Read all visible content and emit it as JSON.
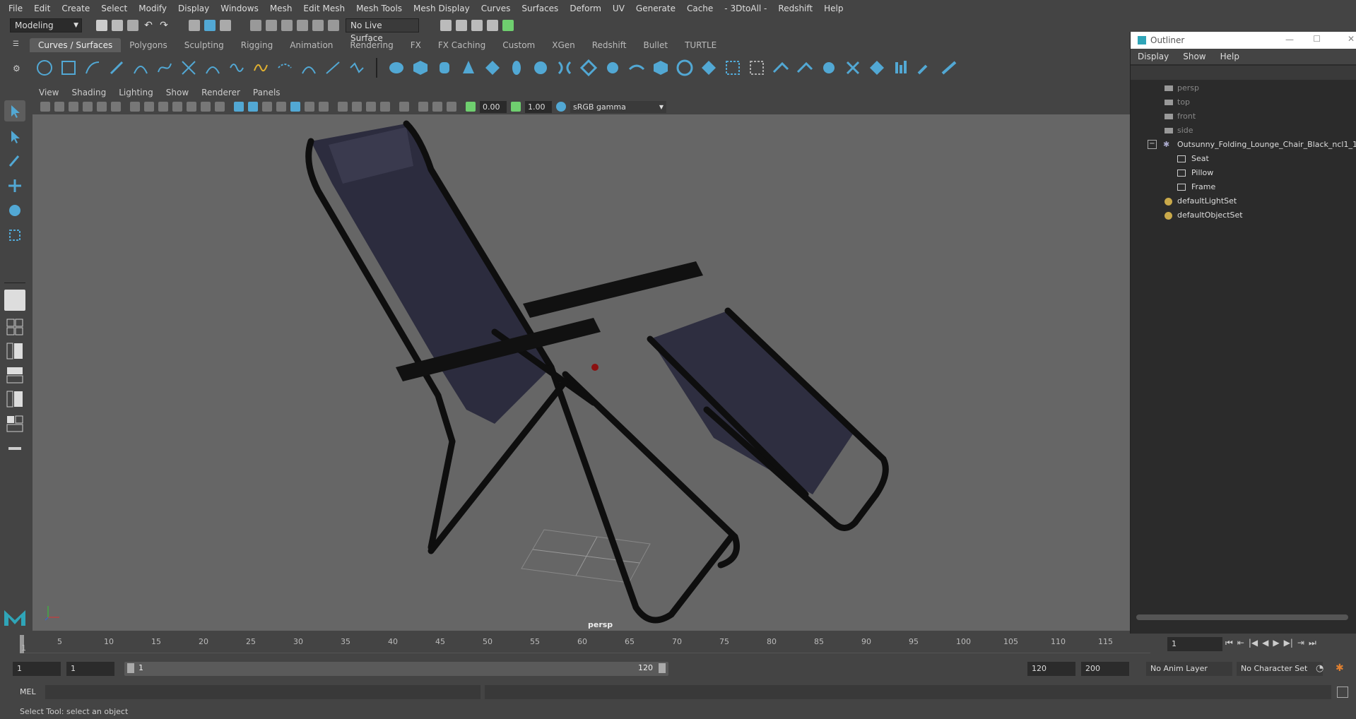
{
  "menubar": {
    "items": [
      "File",
      "Edit",
      "Create",
      "Select",
      "Modify",
      "Display",
      "Windows",
      "Mesh",
      "Edit Mesh",
      "Mesh Tools",
      "Mesh Display",
      "Curves",
      "Surfaces",
      "Deform",
      "UV",
      "Generate",
      "Cache",
      "- 3DtoAll -",
      "Redshift",
      "Help"
    ]
  },
  "statusline": {
    "mode": "Modeling",
    "live_surface": "No Live Surface"
  },
  "shelf": {
    "tabs": [
      "Curves / Surfaces",
      "Polygons",
      "Sculpting",
      "Rigging",
      "Animation",
      "Rendering",
      "FX",
      "FX Caching",
      "Custom",
      "XGen",
      "Redshift",
      "Bullet",
      "TURTLE"
    ]
  },
  "panel": {
    "menu": [
      "View",
      "Shading",
      "Lighting",
      "Show",
      "Renderer",
      "Panels"
    ],
    "exposure": "0.00",
    "gamma": "1.00",
    "color_space": "sRGB gamma",
    "camera_label": "persp"
  },
  "outliner": {
    "title": "Outliner",
    "menu": [
      "Display",
      "Show",
      "Help"
    ],
    "items": [
      {
        "label": "persp"
      },
      {
        "label": "top"
      },
      {
        "label": "front"
      },
      {
        "label": "side"
      },
      {
        "label": "Outsunny_Folding_Lounge_Chair_Black_ncl1_1"
      },
      {
        "label": "Seat"
      },
      {
        "label": "Pillow"
      },
      {
        "label": "Frame"
      },
      {
        "label": "defaultLightSet"
      },
      {
        "label": "defaultObjectSet"
      }
    ]
  },
  "timeline": {
    "ticks": [
      "1",
      "5",
      "10",
      "15",
      "20",
      "25",
      "30",
      "35",
      "40",
      "45",
      "50",
      "55",
      "60",
      "65",
      "70",
      "75",
      "80",
      "85",
      "90",
      "95",
      "100",
      "105",
      "110",
      "115"
    ],
    "current_frame": "1"
  },
  "range": {
    "start": "1",
    "anim_start": "1",
    "slider_start": "1",
    "slider_end": "120",
    "anim_end": "120",
    "end": "200",
    "anim_layer": "No Anim Layer",
    "character_set": "No Character Set"
  },
  "cmdline": {
    "label": "MEL"
  },
  "helpline": {
    "text": "Select Tool: select an object"
  },
  "colors": {
    "accent": "#52a8d4",
    "chair": "#2a2a3a"
  }
}
